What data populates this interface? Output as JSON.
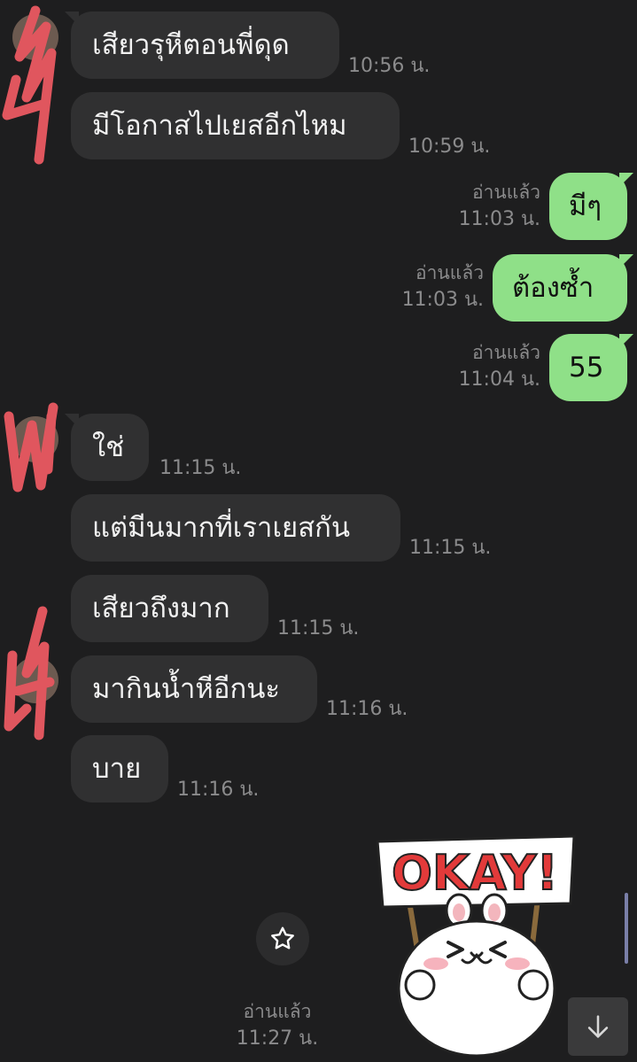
{
  "messages": [
    {
      "text": "เสียวรุหีตอนพี่ดุด",
      "time": "10:56 น."
    },
    {
      "text": "มีโอกาสไปเยสอีกไหม",
      "time": "10:59 น."
    },
    {
      "text": "มีๆ",
      "read": "อ่านแล้ว",
      "time": "11:03 น."
    },
    {
      "text": "ต้องซ้ำ",
      "read": "อ่านแล้ว",
      "time": "11:03 น."
    },
    {
      "text": "55",
      "read": "อ่านแล้ว",
      "time": "11:04 น."
    },
    {
      "text": "ใช่",
      "time": "11:15 น."
    },
    {
      "text": "แต่มีนมากที่เราเยสกัน",
      "time": "11:15 น."
    },
    {
      "text": "เสียวถึงมาก",
      "time": "11:15 น."
    },
    {
      "text": "มากินน้ำหีอีกนะ",
      "time": "11:16 น."
    },
    {
      "text": "บาย",
      "time": "11:16 น."
    }
  ],
  "sticker": {
    "sign_text": "OKAY!",
    "read": "อ่านแล้ว",
    "time": "11:27 น.",
    "icon": "okay-bunny-sticker"
  },
  "controls": {
    "favorite_icon": "star-icon",
    "scroll_down_icon": "arrow-down-icon"
  },
  "colors": {
    "background": "#1e1e1f",
    "incoming_bubble": "#303031",
    "outgoing_bubble": "#8fe088",
    "meta_text": "#8b8b8c",
    "scribble": "#e0565e"
  }
}
